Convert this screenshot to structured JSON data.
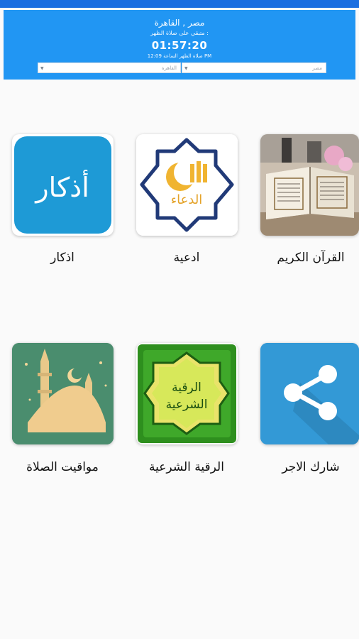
{
  "prayer_widget": {
    "location": "مصر , القاهرة",
    "remaining_label": "متبقي على صلاة الظهر :",
    "countdown": "01:57:20",
    "next_prayer_line": "صلاة الظهر الساعة 12:09 PM",
    "city_select": "القاهرة",
    "method_select": "مصر"
  },
  "grid": {
    "items": [
      {
        "label": "القرآن الكريم",
        "icon": "quran-book-icon"
      },
      {
        "label": "ادعية",
        "icon": "dua-icon",
        "text": "الدعاء"
      },
      {
        "label": "اذكار",
        "icon": "azkar-icon",
        "text": "أذكار"
      },
      {
        "label": "شارك الاجر",
        "icon": "share-icon"
      },
      {
        "label": "الرقية الشرعية",
        "icon": "ruqyah-icon",
        "text": "الرقية الشرعية"
      },
      {
        "label": "مواقيت الصلاة",
        "icon": "mosque-icon"
      }
    ]
  },
  "colors": {
    "top_bar": "#1b6fe0",
    "panel": "#2196f3",
    "azkar_tile": "#1e9ad6",
    "share_tile": "#3399d6",
    "mosque_tile": "#4a8d6e",
    "ruqyah_tile": "#2e8f1e"
  }
}
